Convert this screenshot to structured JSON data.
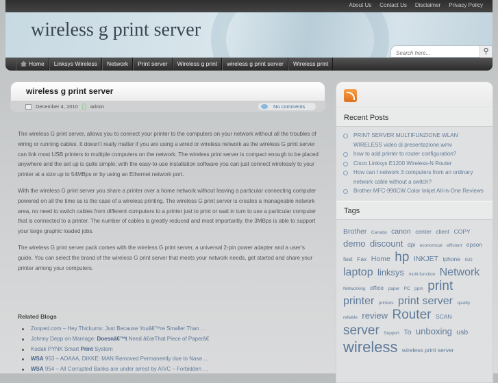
{
  "top_links": [
    "About Us",
    "Contact Us",
    "Disclaimer",
    "Privacy Policy"
  ],
  "site_title": "wireless g print server",
  "search": {
    "placeholder": "Search here..."
  },
  "nav": [
    "Home",
    "Linksys Wireless",
    "Network",
    "Print server",
    "Wireless g print",
    "wireless g print server",
    "Wireless print"
  ],
  "post": {
    "title": "wireless g print server",
    "date": "December 4, 2010",
    "author": "admin",
    "comments": "No comments",
    "paragraphs": [
      "The wireless G print server, allows you to connect your printer to the computers on your network without all the troubles of wiring or running cables. It doesn’t really matter if you are using a wired or wireless network as the wireless G print server can link most USB printers to multiple computers on the network. The wireless print server is compact enough to be placed anywhere and the set up is quite simple; with the easy-to-use installation software you can just connect wirelessly to your printer at a size up to 54MBps or by using an Ethernet network port.",
      "With the wireless G print server you share a printer over a home network without leaving a particular connecting computer powered on all the time as is the case of a wireless printing. The wireless G print server is creates a manageable network area, no need to switch cables from different computers to a printer just to print or wait in turn to use a particular computer that is connected to a printer. The number of cables is greatly reduced and most importantly, the 3MBps is able to support your large graphic loaded jobs.",
      "The wireless G print server pack comes with the wireless G print server, a universal 2-pin power adapter and a user’s guide. You can select the brand of the wireless G print server that meets your network needs, get started and share your printer among your computers."
    ]
  },
  "related": {
    "title": "Related Blogs",
    "items": [
      {
        "pre": "Zooped.com – Hey Thickums: Just Because Youâ€™re Smaller Than …",
        "bold": "",
        "post": ""
      },
      {
        "pre": "Johnny Depp on Marriage: ",
        "bold": "Doesnâ€™t",
        "post": " Need â€œThat Piece of Paperâ€"
      },
      {
        "pre": "Kodak PYNK Smart ",
        "bold": "Print",
        "post": " System"
      },
      {
        "pre": "",
        "bold": "WSA",
        "post": " 953 – AOAAA, DIKKE: MAN Removed Permanently due to Nasa …"
      },
      {
        "pre": "",
        "bold": "WSA",
        "post": " 954 – All Corrupted Banks are under arrest by AIVC – Forbidden …"
      }
    ]
  },
  "sidebar": {
    "recent_title": "Recent Posts",
    "recent": [
      "PRINT SERVER MULTIFUNZIONE WLAN WIRELESS video di presentazione.wmv",
      "how to add printer to router configuration?",
      "Cisco Linksys E1200 Wireless-N Router",
      "How can I network 3 computers from an ordinary network cable without a switch?",
      "Brother MFC-990CW Color Inkjet All-in-One Reviews"
    ],
    "tags_title": "Tags",
    "tags": [
      {
        "t": "Brother",
        "w": 3
      },
      {
        "t": "Canada",
        "w": 1
      },
      {
        "t": "canon",
        "w": 3
      },
      {
        "t": "center",
        "w": 2
      },
      {
        "t": "client",
        "w": 2
      },
      {
        "t": "COPY",
        "w": 2
      },
      {
        "t": "demo",
        "w": 4
      },
      {
        "t": "discount",
        "w": 4
      },
      {
        "t": "dpi",
        "w": 2
      },
      {
        "t": "economical",
        "w": 1
      },
      {
        "t": "efficient",
        "w": 1
      },
      {
        "t": "epson",
        "w": 2
      },
      {
        "t": "fast",
        "w": 2
      },
      {
        "t": "Fax",
        "w": 2
      },
      {
        "t": "Home",
        "w": 3
      },
      {
        "t": "hp",
        "w": 6
      },
      {
        "t": "INKJET",
        "w": 3
      },
      {
        "t": "iphone",
        "w": 2
      },
      {
        "t": "ISO",
        "w": 1
      },
      {
        "t": "laptop",
        "w": 5
      },
      {
        "t": "linksys",
        "w": 4
      },
      {
        "t": "multi-function",
        "w": 1
      },
      {
        "t": "Network",
        "w": 5
      },
      {
        "t": "Networking",
        "w": 1
      },
      {
        "t": "office",
        "w": 2
      },
      {
        "t": "paper",
        "w": 1
      },
      {
        "t": "PC",
        "w": 1
      },
      {
        "t": "ppm",
        "w": 1
      },
      {
        "t": "print",
        "w": 6
      },
      {
        "t": "printer",
        "w": 5
      },
      {
        "t": "printers",
        "w": 1
      },
      {
        "t": "print server",
        "w": 5
      },
      {
        "t": "quality",
        "w": 1
      },
      {
        "t": "reliable",
        "w": 1
      },
      {
        "t": "review",
        "w": 4
      },
      {
        "t": "Router",
        "w": 6
      },
      {
        "t": "SCAN",
        "w": 2
      },
      {
        "t": "server",
        "w": 6
      },
      {
        "t": "Support",
        "w": 1
      },
      {
        "t": "To",
        "w": 3
      },
      {
        "t": "unboxing",
        "w": 4
      },
      {
        "t": "usb",
        "w": 3
      },
      {
        "t": "wireless",
        "w": 7
      },
      {
        "t": "wireless print server",
        "w": 2
      }
    ]
  }
}
